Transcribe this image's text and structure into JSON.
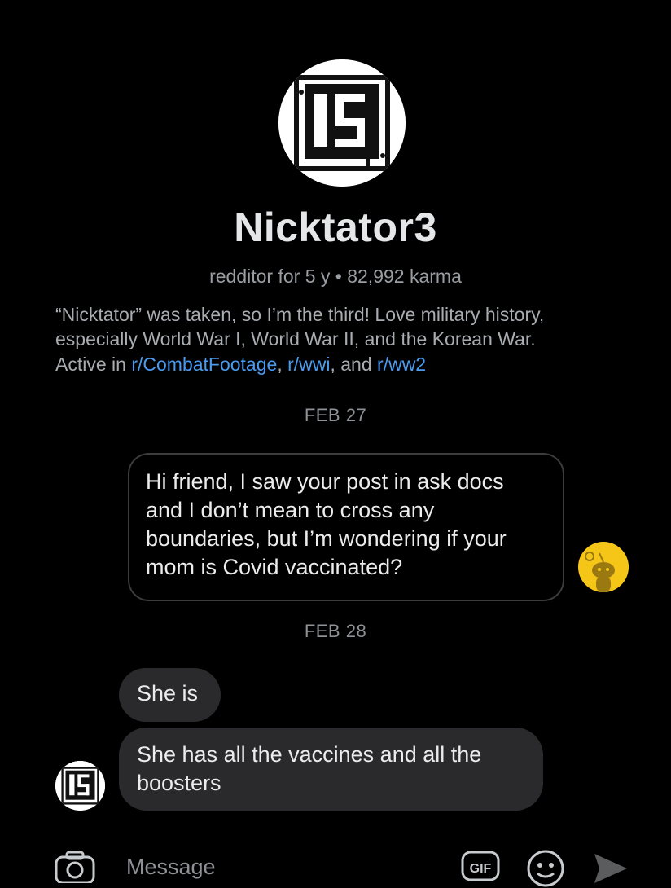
{
  "profile": {
    "username": "Nicktator3",
    "meta": "redditor for 5 y • 82,992 karma",
    "bio": "“Nicktator” was taken, so I’m the third! Love military history, especially World War I, World War II, and the Korean War.",
    "active_prefix": "Active in ",
    "active_communities": [
      "r/CombatFootage",
      "r/wwi",
      "r/ww2"
    ],
    "sep1": ", ",
    "sep2": ", and "
  },
  "conversation": [
    {
      "date": "FEB 27",
      "messages": [
        {
          "sender": "me",
          "text": "Hi friend, I saw your post in ask docs and I don’t mean to cross any boundaries, but I’m wondering if your mom is Covid vaccinated?"
        }
      ]
    },
    {
      "date": "FEB 28",
      "messages": [
        {
          "sender": "Nicktator3",
          "text": "She is"
        },
        {
          "sender": "Nicktator3",
          "text": "She has all the vaccines and all the boosters"
        }
      ]
    }
  ],
  "composer": {
    "placeholder": "Message",
    "camera_icon": "camera-icon",
    "gif_icon": "gif-icon",
    "emoji_icon": "emoji-icon",
    "send_icon": "send-icon",
    "gif_label": "GIF"
  },
  "colors": {
    "background": "#000000",
    "link": "#4a9bf0",
    "incoming_bubble": "#2a2a2c",
    "snoo_avatar": "#f5c518"
  }
}
